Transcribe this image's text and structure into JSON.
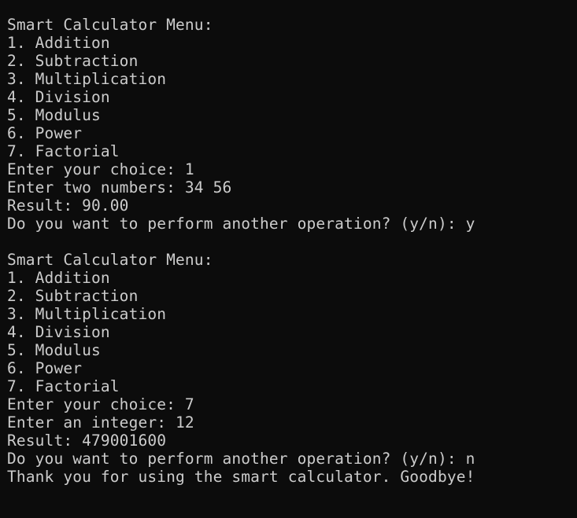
{
  "terminal": {
    "lines": [
      "Smart Calculator Menu:",
      "1. Addition",
      "2. Subtraction",
      "3. Multiplication",
      "4. Division",
      "5. Modulus",
      "6. Power",
      "7. Factorial",
      "Enter your choice: 1",
      "Enter two numbers: 34 56",
      "Result: 90.00",
      "Do you want to perform another operation? (y/n): y",
      "",
      "Smart Calculator Menu:",
      "1. Addition",
      "2. Subtraction",
      "3. Multiplication",
      "4. Division",
      "5. Modulus",
      "6. Power",
      "7. Factorial",
      "Enter your choice: 7",
      "Enter an integer: 12",
      "Result: 479001600",
      "Do you want to perform another operation? (y/n): n",
      "Thank you for using the smart calculator. Goodbye!"
    ],
    "colors": {
      "background": "#0c0c0c",
      "foreground": "#cccccc"
    }
  }
}
